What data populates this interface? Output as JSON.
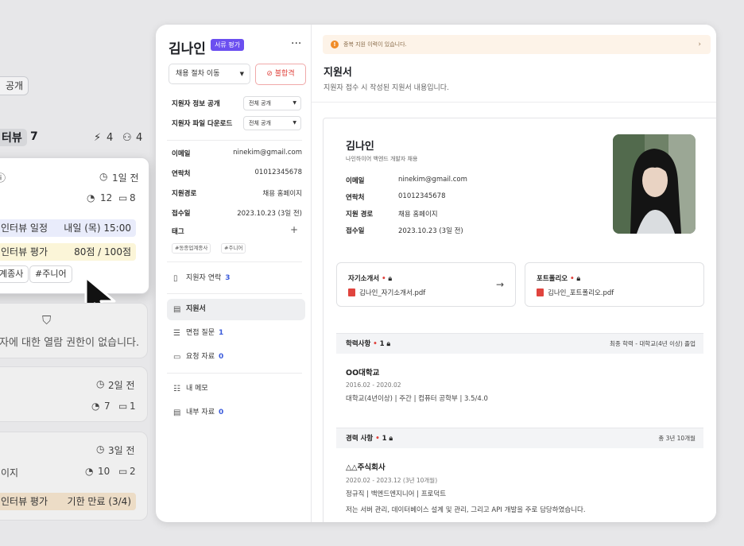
{
  "left_board": {
    "visibility_chip": "공개",
    "column": {
      "title": "터뷰",
      "count": "7",
      "stat_a": "4",
      "stat_b": "4"
    },
    "card1": {
      "time": "1일 전",
      "c1": "12",
      "c2": "8",
      "row1_label": "인터뷰 일정",
      "row1_value": "내일 (목) 15:00",
      "row2_label": "인터뷰 평가",
      "row2_value": "80점 / 100점",
      "tag1": "계종사",
      "tag2": "#주니어"
    },
    "locked_text": "자에 대한 열람 권한이 없습니다.",
    "card3": {
      "time": "2일 전",
      "c1": "7",
      "c2": "1"
    },
    "card4": {
      "time": "3일 전",
      "label": "이지",
      "c1": "10",
      "c2": "2",
      "row_label": "인터뷰 평가",
      "row_value": "기한 만료 (3/4)"
    }
  },
  "sidebar": {
    "name": "김나인",
    "badge": "서류 평가",
    "more": "···",
    "move_select": "채용 절차 이동",
    "reject": "불합격",
    "info_label": "지원자 정보 공개",
    "info_value": "전체 공개",
    "file_label": "지원자 파일 다운로드",
    "file_value": "전체 공개",
    "fields": [
      {
        "k": "이메일",
        "v": "ninekim@gmail.com"
      },
      {
        "k": "연락처",
        "v": "01012345678"
      },
      {
        "k": "지원경로",
        "v": "채용 홈페이지"
      },
      {
        "k": "접수일",
        "v": "2023.10.23 (3일 전)"
      }
    ],
    "tags_label": "태그",
    "tags_add": "+",
    "tags": [
      "#동종업계종사",
      "#주니어"
    ],
    "nav": [
      {
        "label": "지원자 연락",
        "count": "3"
      },
      {
        "label": "지원서",
        "count": ""
      },
      {
        "label": "면접 질문",
        "count": "1"
      },
      {
        "label": "요청 자료",
        "count": "0"
      },
      {
        "label": "내 메모",
        "count": ""
      },
      {
        "label": "내부 자료",
        "count": "0"
      }
    ]
  },
  "content": {
    "alert": "중복 지원 이력이 있습니다.",
    "alert_icon": "!",
    "alert_chevron": "›",
    "title": "지원서",
    "subtitle": "지원자 접수 시 작성된 지원서 내용입니다.",
    "applicant": {
      "name": "김나인",
      "role": "나인하이어 백엔드 개발자 채용",
      "fields": [
        {
          "k": "이메일",
          "v": "ninekim@gmail.com"
        },
        {
          "k": "연락처",
          "v": "01012345678"
        },
        {
          "k": "지원 경로",
          "v": "채용 홈페이지"
        },
        {
          "k": "접수일",
          "v": "2023.10.23 (3일 전)"
        }
      ]
    },
    "files": [
      {
        "title": "자기소개서",
        "file": "김나인_자기소개서.pdf"
      },
      {
        "title": "포트폴리오",
        "file": "김나인_포트폴리오.pdf"
      }
    ],
    "required_dot": "•",
    "file_arrow": "→",
    "education": {
      "title": "학력사항",
      "count": "1",
      "summary": "최종 학력 - 대학교(4년 이상) 졸업",
      "school": "OO대학교",
      "period": "2016.02 - 2020.02",
      "detail": "대학교(4년이상) | 주간 | 컴퓨터 공학부 | 3.5/4.0"
    },
    "career": {
      "title": "경력 사항",
      "count": "1",
      "summary": "총 3년 10개월",
      "company": "△△주식회사",
      "period": "2020.02 - 2023.12 (3년 10개월)",
      "detail": "정규직 | 백엔드엔지니어 | 프로덕트",
      "desc": "저는 서버 관리, 데이터베이스 설계 및 관리, 그리고 API 개발을 주로 담당하였습니다."
    }
  },
  "colors": {
    "accent": "#6b4ff0",
    "danger": "#e0443e",
    "link": "#3b5bdb",
    "alert_bg": "#fdf3e8"
  }
}
